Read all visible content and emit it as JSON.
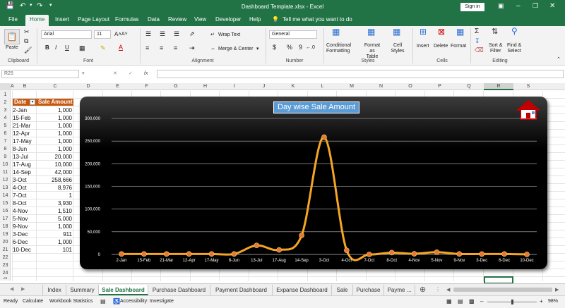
{
  "titlebar": {
    "title": "Dashboard Template.xlsx  -  Excel",
    "search": "Tell me what you want to do",
    "signin": "Sign in"
  },
  "menu": [
    "File",
    "Home",
    "Insert",
    "Page Layout",
    "Formulas",
    "Data",
    "Review",
    "View",
    "Developer",
    "Help"
  ],
  "ribbon": {
    "clipboard": {
      "label": "Clipboard",
      "paste": "Paste"
    },
    "font": {
      "label": "Font",
      "name": "Arial",
      "size": "11",
      "bold": "B",
      "italic": "I",
      "underline": "U"
    },
    "alignment": {
      "label": "Alignment",
      "wrap": "Wrap Text",
      "merge": "Merge & Center"
    },
    "number": {
      "label": "Number",
      "format": "General",
      "currency": "$",
      "percent": "%",
      "comma": "9"
    },
    "styles": {
      "label": "Styles",
      "conditional": [
        "Conditional",
        "Formatting"
      ],
      "format_table": [
        "Format as",
        "Table"
      ],
      "cell_styles": [
        "Cell",
        "Styles"
      ]
    },
    "cells": {
      "label": "Cells",
      "insert": "Insert",
      "delete": "Delete",
      "format": "Format"
    },
    "editing": {
      "label": "Editing",
      "sort": [
        "Sort &",
        "Filter"
      ],
      "find": [
        "Find &",
        "Select"
      ]
    }
  },
  "formula_bar": {
    "name_box": "R25",
    "fx": "fx",
    "value": ""
  },
  "columns": [
    "A",
    "B",
    "C",
    "D",
    "E",
    "F",
    "G",
    "H",
    "I",
    "J",
    "K",
    "L",
    "M",
    "N",
    "O",
    "P",
    "Q",
    "R",
    "S"
  ],
  "rows": [
    "1",
    "2",
    "3",
    "4",
    "5",
    "6",
    "7",
    "8",
    "9",
    "10",
    "11",
    "12",
    "13",
    "14",
    "15",
    "16",
    "17",
    "18",
    "19",
    "20",
    "21",
    "22",
    "23",
    "24",
    "25"
  ],
  "table": {
    "headers": [
      "Date",
      "Sale Amount"
    ],
    "rows": [
      [
        "2-Jan",
        "1,000"
      ],
      [
        "15-Feb",
        "1,000"
      ],
      [
        "21-Mar",
        "1,000"
      ],
      [
        "12-Apr",
        "1,000"
      ],
      [
        "17-May",
        "1,000"
      ],
      [
        "8-Jun",
        "1,000"
      ],
      [
        "13-Jul",
        "20,000"
      ],
      [
        "17-Aug",
        "10,000"
      ],
      [
        "14-Sep",
        "42,000"
      ],
      [
        "3-Oct",
        "258,666"
      ],
      [
        "4-Oct",
        "8,976"
      ],
      [
        "7-Oct",
        "1"
      ],
      [
        "8-Oct",
        "3,930"
      ],
      [
        "4-Nov",
        "1,510"
      ],
      [
        "5-Nov",
        "5,000"
      ],
      [
        "9-Nov",
        "1,000"
      ],
      [
        "3-Dec",
        "911"
      ],
      [
        "6-Dec",
        "1,000"
      ],
      [
        "10-Dec",
        "101"
      ]
    ]
  },
  "chart_data": {
    "type": "line",
    "title": "Day wise Sale Amount",
    "categories": [
      "2-Jan",
      "15-Feb",
      "21-Mar",
      "12-Apr",
      "17-May",
      "8-Jun",
      "13-Jul",
      "17-Aug",
      "14-Sep",
      "3-Oct",
      "4-Oct",
      "7-Oct",
      "8-Oct",
      "4-Nov",
      "5-Nov",
      "9-Nov",
      "3-Dec",
      "6-Dec",
      "10-Dec"
    ],
    "values": [
      1000,
      1000,
      1000,
      1000,
      1000,
      1000,
      20000,
      10000,
      42000,
      258666,
      8976,
      1,
      3930,
      1510,
      5000,
      1000,
      911,
      1000,
      101
    ],
    "ylim": [
      0,
      300000
    ],
    "yticks": [
      "0",
      "50,000",
      "100,000",
      "150,000",
      "200,000",
      "250,000",
      "300,000"
    ],
    "smooth": true,
    "grid": true,
    "line_color": "#f5a623",
    "marker_color": "#e8782a",
    "title_bg": "#5b9bd5"
  },
  "sheet_tabs": [
    "Index",
    "Summary",
    "Sale Dashboard",
    "Purchase Dashboard",
    "Payment Dashboard",
    "Expanse Dashboard",
    "Sale",
    "Purchase",
    "Payme ..."
  ],
  "active_tab": "Sale Dashboard",
  "status": {
    "ready": "Ready",
    "calculate": "Calculate",
    "stats": "Workbook Statistics",
    "accessibility": "Accessibility: Investigate",
    "zoom": "98%"
  },
  "colors": {
    "excel_green": "#217346",
    "table_header": "#c65911"
  }
}
